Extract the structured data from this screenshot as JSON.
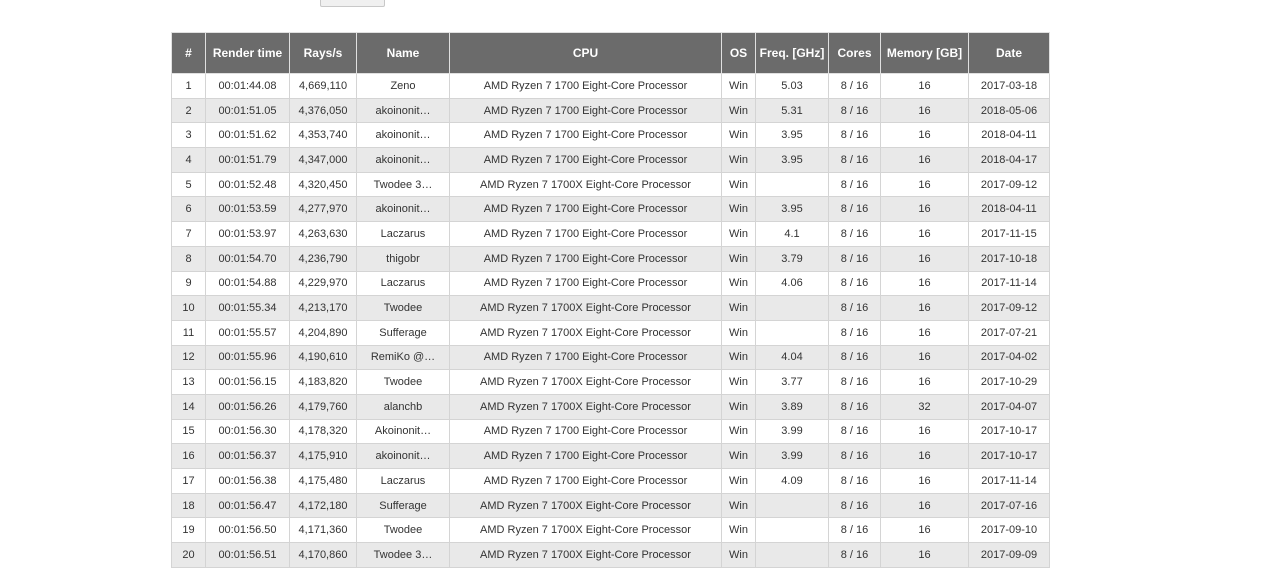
{
  "columns": {
    "num": "#",
    "render_time": "Render time",
    "rays": "Rays/s",
    "name": "Name",
    "cpu": "CPU",
    "os": "OS",
    "freq": "Freq. [GHz]",
    "cores": "Cores",
    "memory": "Memory [GB]",
    "date": "Date"
  },
  "rows": [
    {
      "num": "1",
      "time": "00:01:44.08",
      "rays": "4,669,110",
      "name": "Zeno",
      "cpu": "AMD Ryzen 7 1700 Eight-Core Processor",
      "os": "Win",
      "freq": "5.03",
      "cores": "8 / 16",
      "mem": "16",
      "date": "2017-03-18"
    },
    {
      "num": "2",
      "time": "00:01:51.05",
      "rays": "4,376,050",
      "name": "akoinonit…",
      "cpu": "AMD Ryzen 7 1700 Eight-Core Processor",
      "os": "Win",
      "freq": "5.31",
      "cores": "8 / 16",
      "mem": "16",
      "date": "2018-05-06"
    },
    {
      "num": "3",
      "time": "00:01:51.62",
      "rays": "4,353,740",
      "name": "akoinonit…",
      "cpu": "AMD Ryzen 7 1700 Eight-Core Processor",
      "os": "Win",
      "freq": "3.95",
      "cores": "8 / 16",
      "mem": "16",
      "date": "2018-04-11"
    },
    {
      "num": "4",
      "time": "00:01:51.79",
      "rays": "4,347,000",
      "name": "akoinonit…",
      "cpu": "AMD Ryzen 7 1700 Eight-Core Processor",
      "os": "Win",
      "freq": "3.95",
      "cores": "8 / 16",
      "mem": "16",
      "date": "2018-04-17"
    },
    {
      "num": "5",
      "time": "00:01:52.48",
      "rays": "4,320,450",
      "name": "Twodee 3…",
      "cpu": "AMD Ryzen 7 1700X Eight-Core Processor",
      "os": "Win",
      "freq": "",
      "cores": "8 / 16",
      "mem": "16",
      "date": "2017-09-12"
    },
    {
      "num": "6",
      "time": "00:01:53.59",
      "rays": "4,277,970",
      "name": "akoinonit…",
      "cpu": "AMD Ryzen 7 1700 Eight-Core Processor",
      "os": "Win",
      "freq": "3.95",
      "cores": "8 / 16",
      "mem": "16",
      "date": "2018-04-11"
    },
    {
      "num": "7",
      "time": "00:01:53.97",
      "rays": "4,263,630",
      "name": "Laczarus",
      "cpu": "AMD Ryzen 7 1700 Eight-Core Processor",
      "os": "Win",
      "freq": "4.1",
      "cores": "8 / 16",
      "mem": "16",
      "date": "2017-11-15"
    },
    {
      "num": "8",
      "time": "00:01:54.70",
      "rays": "4,236,790",
      "name": "thigobr",
      "cpu": "AMD Ryzen 7 1700 Eight-Core Processor",
      "os": "Win",
      "freq": "3.79",
      "cores": "8 / 16",
      "mem": "16",
      "date": "2017-10-18"
    },
    {
      "num": "9",
      "time": "00:01:54.88",
      "rays": "4,229,970",
      "name": "Laczarus",
      "cpu": "AMD Ryzen 7 1700 Eight-Core Processor",
      "os": "Win",
      "freq": "4.06",
      "cores": "8 / 16",
      "mem": "16",
      "date": "2017-11-14"
    },
    {
      "num": "10",
      "time": "00:01:55.34",
      "rays": "4,213,170",
      "name": "Twodee",
      "cpu": "AMD Ryzen 7 1700X Eight-Core Processor",
      "os": "Win",
      "freq": "",
      "cores": "8 / 16",
      "mem": "16",
      "date": "2017-09-12"
    },
    {
      "num": "11",
      "time": "00:01:55.57",
      "rays": "4,204,890",
      "name": "Sufferage",
      "cpu": "AMD Ryzen 7 1700X Eight-Core Processor",
      "os": "Win",
      "freq": "",
      "cores": "8 / 16",
      "mem": "16",
      "date": "2017-07-21"
    },
    {
      "num": "12",
      "time": "00:01:55.96",
      "rays": "4,190,610",
      "name": "RemiKo @…",
      "cpu": "AMD Ryzen 7 1700 Eight-Core Processor",
      "os": "Win",
      "freq": "4.04",
      "cores": "8 / 16",
      "mem": "16",
      "date": "2017-04-02"
    },
    {
      "num": "13",
      "time": "00:01:56.15",
      "rays": "4,183,820",
      "name": "Twodee",
      "cpu": "AMD Ryzen 7 1700X Eight-Core Processor",
      "os": "Win",
      "freq": "3.77",
      "cores": "8 / 16",
      "mem": "16",
      "date": "2017-10-29"
    },
    {
      "num": "14",
      "time": "00:01:56.26",
      "rays": "4,179,760",
      "name": "alanchb",
      "cpu": "AMD Ryzen 7 1700X Eight-Core Processor",
      "os": "Win",
      "freq": "3.89",
      "cores": "8 / 16",
      "mem": "32",
      "date": "2017-04-07"
    },
    {
      "num": "15",
      "time": "00:01:56.30",
      "rays": "4,178,320",
      "name": "Akoinonit…",
      "cpu": "AMD Ryzen 7 1700 Eight-Core Processor",
      "os": "Win",
      "freq": "3.99",
      "cores": "8 / 16",
      "mem": "16",
      "date": "2017-10-17"
    },
    {
      "num": "16",
      "time": "00:01:56.37",
      "rays": "4,175,910",
      "name": "akoinonit…",
      "cpu": "AMD Ryzen 7 1700 Eight-Core Processor",
      "os": "Win",
      "freq": "3.99",
      "cores": "8 / 16",
      "mem": "16",
      "date": "2017-10-17"
    },
    {
      "num": "17",
      "time": "00:01:56.38",
      "rays": "4,175,480",
      "name": "Laczarus",
      "cpu": "AMD Ryzen 7 1700 Eight-Core Processor",
      "os": "Win",
      "freq": "4.09",
      "cores": "8 / 16",
      "mem": "16",
      "date": "2017-11-14"
    },
    {
      "num": "18",
      "time": "00:01:56.47",
      "rays": "4,172,180",
      "name": "Sufferage",
      "cpu": "AMD Ryzen 7 1700X Eight-Core Processor",
      "os": "Win",
      "freq": "",
      "cores": "8 / 16",
      "mem": "16",
      "date": "2017-07-16"
    },
    {
      "num": "19",
      "time": "00:01:56.50",
      "rays": "4,171,360",
      "name": "Twodee",
      "cpu": "AMD Ryzen 7 1700X Eight-Core Processor",
      "os": "Win",
      "freq": "",
      "cores": "8 / 16",
      "mem": "16",
      "date": "2017-09-10"
    },
    {
      "num": "20",
      "time": "00:01:56.51",
      "rays": "4,170,860",
      "name": "Twodee 3…",
      "cpu": "AMD Ryzen 7 1700X Eight-Core Processor",
      "os": "Win",
      "freq": "",
      "cores": "8 / 16",
      "mem": "16",
      "date": "2017-09-09"
    }
  ]
}
